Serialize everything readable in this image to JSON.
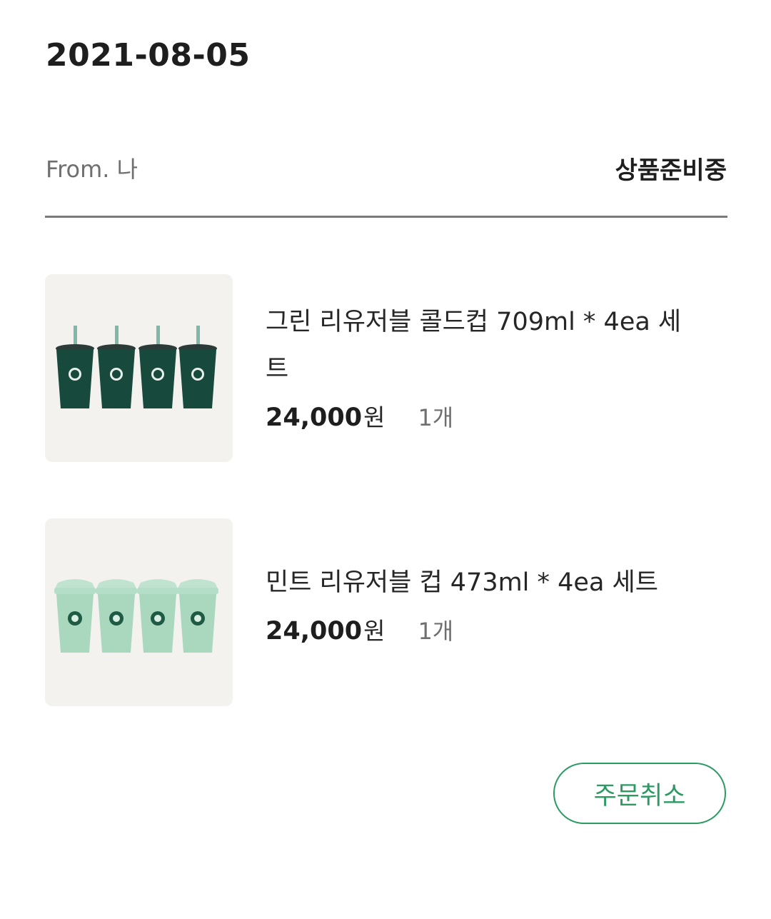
{
  "order": {
    "date": "2021-08-05",
    "from": "From. 나",
    "status": "상품준비중"
  },
  "products": [
    {
      "name": "그린 리유저블 콜드컵 709ml * 4ea 세트",
      "price": "24,000",
      "currency": "원",
      "quantity": "1개",
      "cup_color": "#1b4a3e",
      "image": "green-cold-cups-icon"
    },
    {
      "name": "민트 리유저블 컵 473ml * 4ea 세트",
      "price": "24,000",
      "currency": "원",
      "quantity": "1개",
      "cup_color": "#a9d8bf",
      "image": "mint-cups-icon"
    }
  ],
  "actions": {
    "cancel_label": "주문취소"
  },
  "colors": {
    "accent": "#2b9a63",
    "thumb_bg": "#f3f2ee"
  }
}
